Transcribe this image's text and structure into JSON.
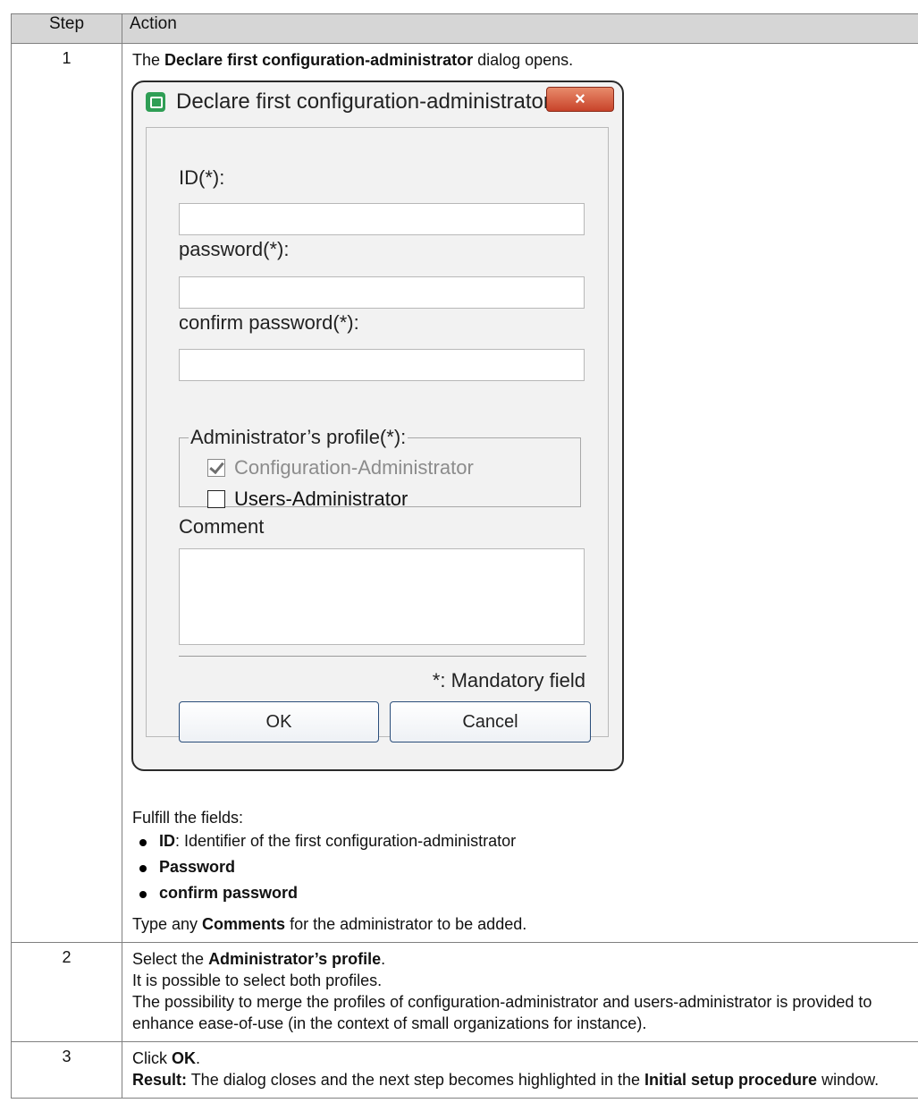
{
  "table": {
    "header_step": "Step",
    "header_action": "Action"
  },
  "row1": {
    "step": "1",
    "intro_pre": "The ",
    "intro_bold": "Declare first configuration-administrator",
    "intro_post": " dialog opens.",
    "dialog": {
      "title": "Declare first configuration-administrator",
      "close_label": "×",
      "id_label": "ID(*):",
      "id_value": "",
      "password_label": "password(*):",
      "password_value": "",
      "confirm_label": "confirm password(*):",
      "confirm_value": "",
      "profile_legend": "Administrator’s profile(*):",
      "profile_config": "Configuration-Administrator",
      "profile_config_checked": true,
      "profile_users": "Users-Administrator",
      "profile_users_checked": false,
      "comment_label": "Comment",
      "comment_value": "",
      "mandatory_note": "*: Mandatory field",
      "ok_label": "OK",
      "cancel_label": "Cancel"
    },
    "fulfill": "Fulfill the fields:",
    "bullet1_bold": "ID",
    "bullet1_rest": ": Identifier of the first configuration-administrator",
    "bullet2": "Password",
    "bullet3": "confirm password",
    "comments_pre": "Type any ",
    "comments_bold": "Comments",
    "comments_post": " for the administrator to be added."
  },
  "row2": {
    "step": "2",
    "line1_pre": "Select the ",
    "line1_bold": "Administrator’s profile",
    "line1_post": ".",
    "line2": "It is possible to select both profiles.",
    "line3": "The possibility to merge the profiles of configuration-administrator and users-administrator is provided to enhance ease-of-use (in the context of small organizations for instance)."
  },
  "row3": {
    "step": "3",
    "line1_pre": "Click ",
    "line1_bold": "OK",
    "line1_post": ".",
    "result_bold": "Result:",
    "result_text": " The dialog closes and the next step becomes highlighted in the ",
    "result_bold2": "Initial setup procedure",
    "result_post": " window."
  }
}
